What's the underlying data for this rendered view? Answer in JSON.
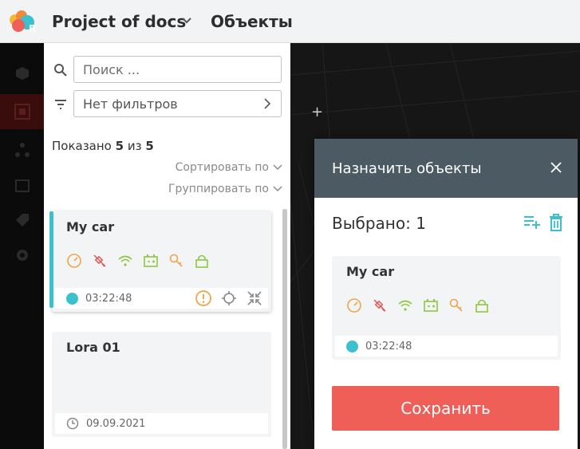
{
  "header": {
    "project": "Project of docs",
    "section": "Объекты"
  },
  "sidebar": {
    "search": {
      "placeholder": "Поиск ..."
    },
    "filter": {
      "value": "Нет фильтров"
    },
    "shown": {
      "prefix": "Показано",
      "count": "5",
      "of": "из",
      "total": "5"
    },
    "sort_label": "Сортировать по",
    "group_label": "Группировать по",
    "items": [
      {
        "name": "My car",
        "time": "03:22:48",
        "icons": [
          "speedometer-icon",
          "satellite-off-icon",
          "wifi-icon",
          "battery-icon",
          "key-icon",
          "lock-icon"
        ]
      },
      {
        "name": "Lora 01",
        "date": "09.09.2021"
      }
    ]
  },
  "modal": {
    "title": "Назначить объекты",
    "selected_label": "Выбрано: 1",
    "item": {
      "name": "My car",
      "time": "03:22:48"
    },
    "save_label": "Сохранить"
  },
  "colors": {
    "accent": "#3bc0cd",
    "save": "#ef5f58",
    "modal_header": "#4c5b63",
    "warning": "#f0a54a",
    "error": "#e05656",
    "ok": "#8dc63f"
  }
}
